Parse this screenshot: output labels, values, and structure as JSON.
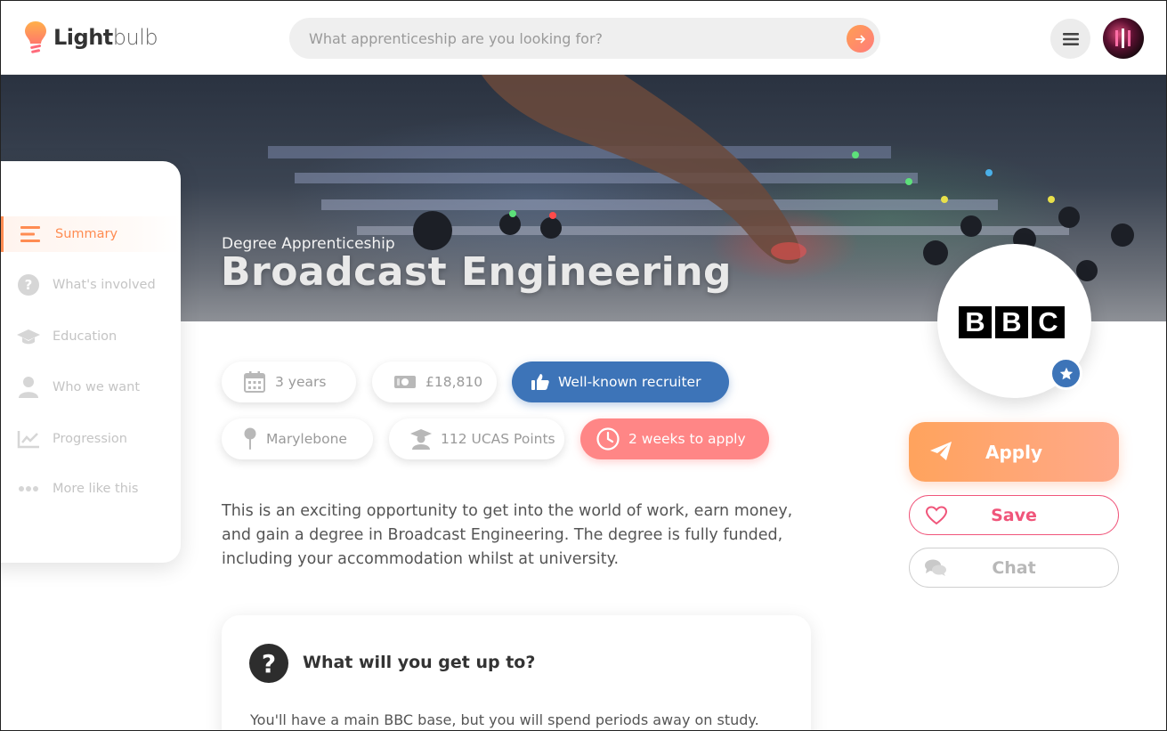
{
  "header": {
    "logo_bold": "Light",
    "logo_light": "bulb",
    "search_placeholder": "What apprenticeship are you looking for?"
  },
  "hero": {
    "subtitle": "Degree Apprenticeship",
    "title": "Broadcast Engineering"
  },
  "sidebar": {
    "items": [
      {
        "label": "Summary",
        "icon": "list-icon",
        "active": true
      },
      {
        "label": "What's involved",
        "icon": "question-icon"
      },
      {
        "label": "Education",
        "icon": "graduation-cap-icon"
      },
      {
        "label": "Who we want",
        "icon": "person-icon"
      },
      {
        "label": "Progression",
        "icon": "chart-icon"
      },
      {
        "label": "More like this",
        "icon": "more-dots-icon"
      }
    ]
  },
  "pills": {
    "duration": "3 years",
    "salary": "£18,810",
    "recruiter": "Well-known recruiter",
    "location": "Marylebone",
    "ucas": "112 UCAS Points",
    "deadline": "2 weeks to apply"
  },
  "description": "This is an exciting opportunity to get into the world of work, earn money, and gain a degree in Broadcast Engineering. The degree is fully funded, including your accommodation whilst at university.",
  "card": {
    "icon": "?",
    "title": "What will you get up to?",
    "text": "You'll have a main BBC base, but you will spend periods away on study."
  },
  "org": {
    "letters": [
      "B",
      "B",
      "C"
    ]
  },
  "actions": {
    "apply": "Apply",
    "save": "Save",
    "chat": "Chat"
  },
  "colors": {
    "accent_orange": "#ff8c52",
    "blue": "#3d74b8",
    "red": "#ff8686",
    "save_pink": "#f0557a"
  }
}
